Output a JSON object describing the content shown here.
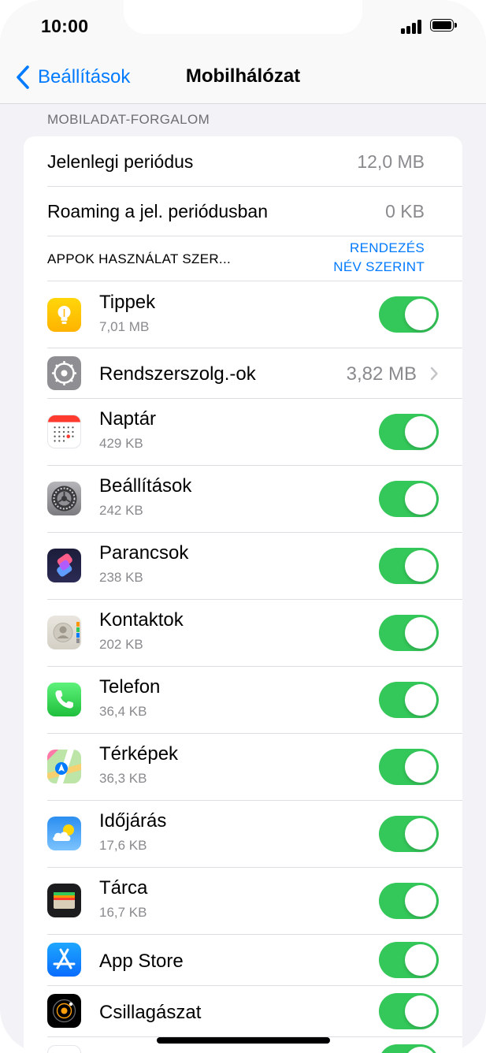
{
  "status_bar": {
    "time": "10:00"
  },
  "nav": {
    "back_label": "Beállítások",
    "title": "Mobilhálózat"
  },
  "section_header": "MOBILADAT-FORGALOM",
  "usage": [
    {
      "label": "Jelenlegi periódus",
      "value": "12,0 MB"
    },
    {
      "label": "Roaming a jel. periódusban",
      "value": "0 KB"
    }
  ],
  "apps_header": {
    "title": "APPOK HASZNÁLAT SZER...",
    "sort_line1": "RENDEZÉS",
    "sort_line2": "NÉV SZERINT"
  },
  "apps": [
    {
      "name": "Tippek",
      "size": "7,01 MB",
      "icon": "tips-icon",
      "toggle_on": true
    },
    {
      "name": "Rendszerszolg.-ok",
      "size": "3,82 MB",
      "icon": "system-services-icon",
      "toggle_on": null
    },
    {
      "name": "Naptár",
      "size": "429 KB",
      "icon": "calendar-icon",
      "toggle_on": true
    },
    {
      "name": "Beállítások",
      "size": "242 KB",
      "icon": "settings-icon",
      "toggle_on": true
    },
    {
      "name": "Parancsok",
      "size": "238 KB",
      "icon": "shortcuts-icon",
      "toggle_on": true
    },
    {
      "name": "Kontaktok",
      "size": "202 KB",
      "icon": "contacts-icon",
      "toggle_on": true
    },
    {
      "name": "Telefon",
      "size": "36,4 KB",
      "icon": "phone-icon",
      "toggle_on": true
    },
    {
      "name": "Térképek",
      "size": "36,3 KB",
      "icon": "maps-icon",
      "toggle_on": true
    },
    {
      "name": "Időjárás",
      "size": "17,6 KB",
      "icon": "weather-icon",
      "toggle_on": true
    },
    {
      "name": "Tárca",
      "size": "16,7 KB",
      "icon": "wallet-icon",
      "toggle_on": true
    },
    {
      "name": "App Store",
      "size": "",
      "icon": "app-store-icon",
      "toggle_on": true
    },
    {
      "name": "Csillagászat",
      "size": "",
      "icon": "astronomy-icon",
      "toggle_on": true
    },
    {
      "name": "",
      "size": "",
      "icon": "health-icon",
      "toggle_on": true
    }
  ],
  "colors": {
    "accent": "#007aff",
    "toggle_on": "#34c759",
    "background": "#f2f2f7"
  }
}
